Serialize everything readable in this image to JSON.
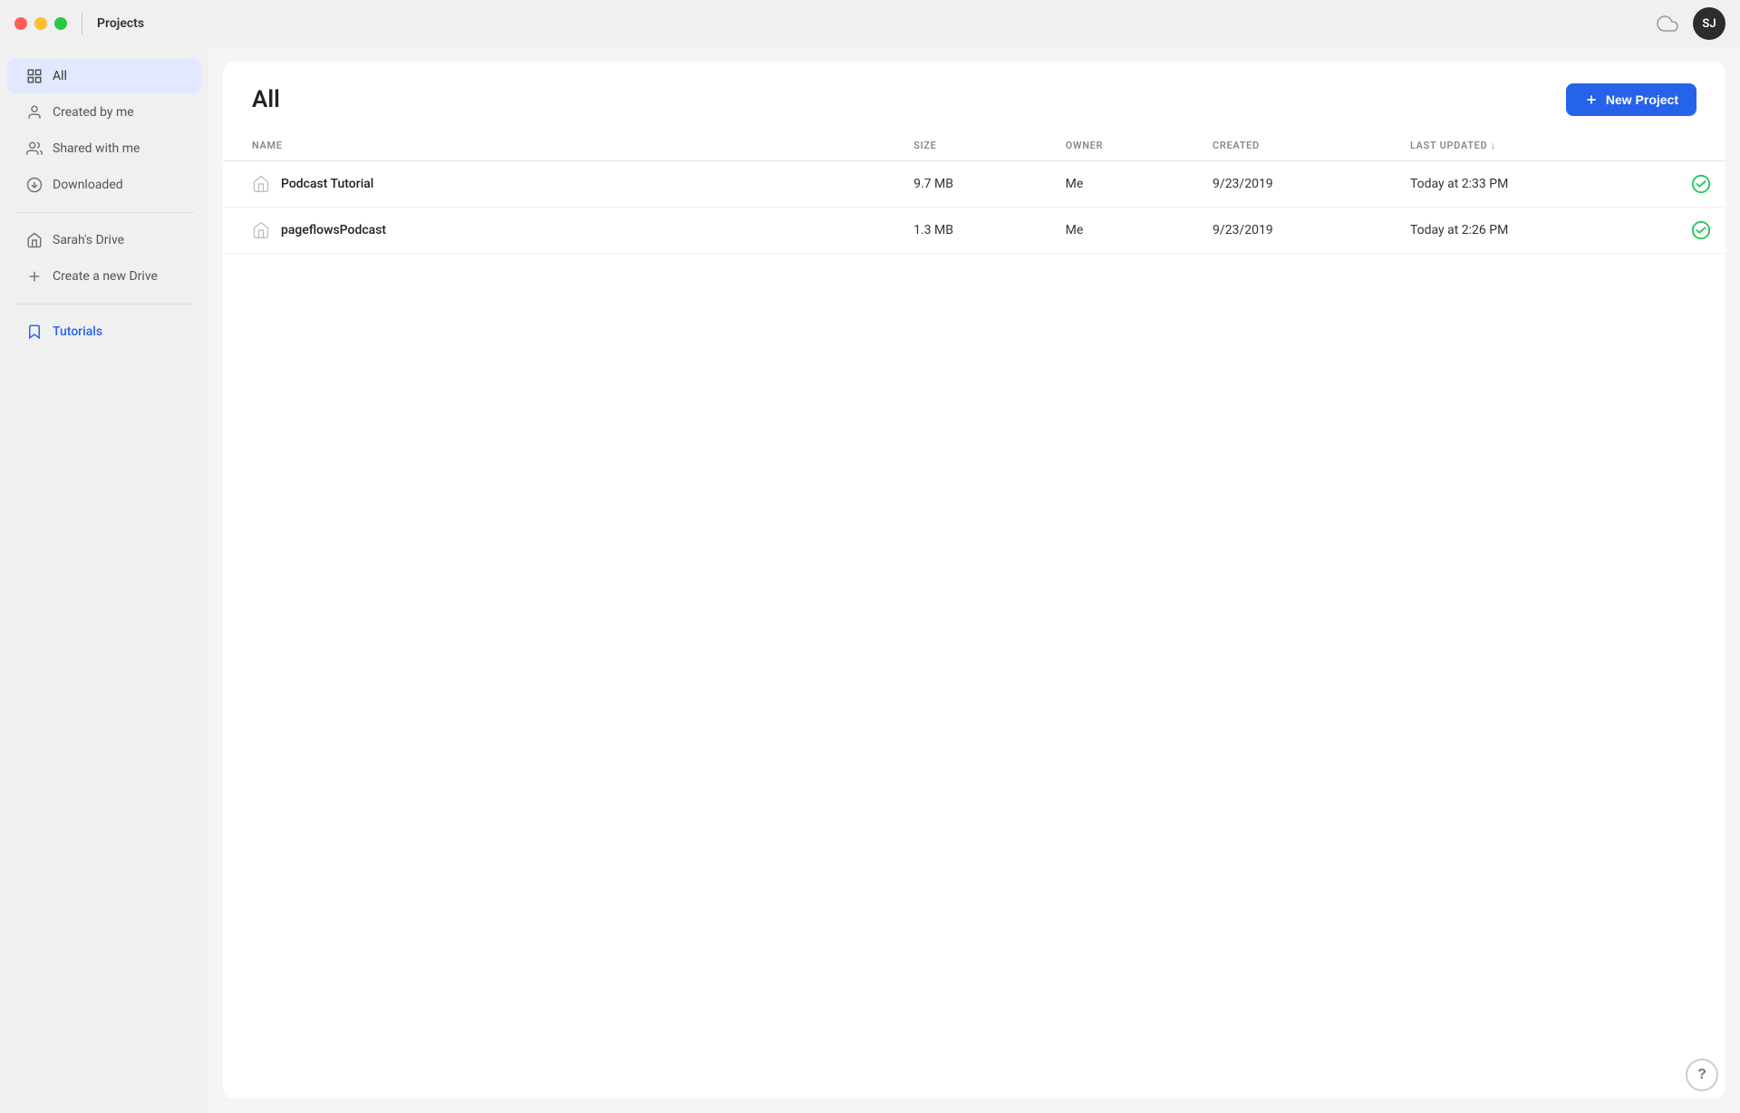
{
  "titlebar": {
    "title": "Projects",
    "avatar_initials": "SJ"
  },
  "sidebar": {
    "items": [
      {
        "id": "all",
        "label": "All",
        "active": true,
        "icon": "list-icon"
      },
      {
        "id": "created-by-me",
        "label": "Created by me",
        "active": false,
        "icon": "user-icon"
      },
      {
        "id": "shared-with-me",
        "label": "Shared with me",
        "active": false,
        "icon": "share-icon"
      },
      {
        "id": "downloaded",
        "label": "Downloaded",
        "active": false,
        "icon": "download-icon"
      }
    ],
    "drives": [
      {
        "id": "sarahs-drive",
        "label": "Sarah's Drive",
        "icon": "home-icon"
      }
    ],
    "create_drive_label": "Create a new Drive",
    "tutorials_label": "Tutorials"
  },
  "content": {
    "title": "All",
    "new_project_button": "+ New Project",
    "table": {
      "columns": [
        {
          "id": "name",
          "label": "NAME"
        },
        {
          "id": "size",
          "label": "SIZE"
        },
        {
          "id": "owner",
          "label": "OWNER"
        },
        {
          "id": "created",
          "label": "CREATED"
        },
        {
          "id": "last_updated",
          "label": "LAST UPDATED ↓"
        }
      ],
      "rows": [
        {
          "name": "Podcast Tutorial",
          "size": "9.7 MB",
          "owner": "Me",
          "created": "9/23/2019",
          "last_updated": "Today at 2:33 PM",
          "status": "synced"
        },
        {
          "name": "pageflowsPodcast",
          "size": "1.3 MB",
          "owner": "Me",
          "created": "9/23/2019",
          "last_updated": "Today at 2:26 PM",
          "status": "synced"
        }
      ]
    }
  },
  "help_button_label": "?"
}
